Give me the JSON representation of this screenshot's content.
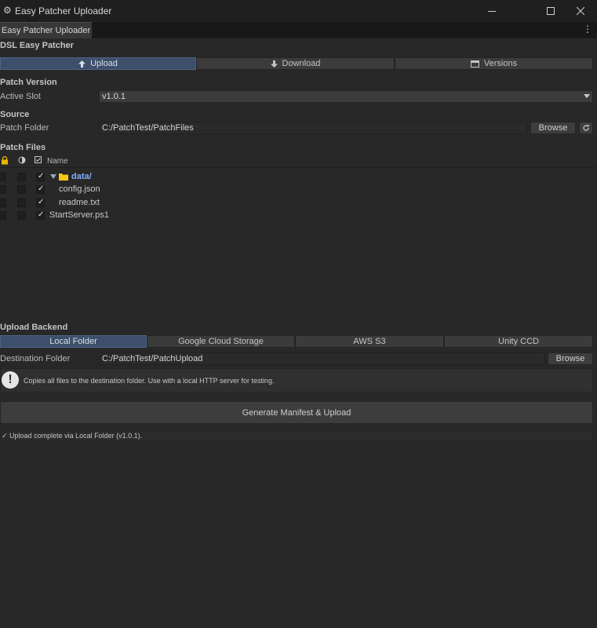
{
  "window": {
    "title": "Easy Patcher Uploader",
    "icon": "gears-icon"
  },
  "tab": {
    "label": "Easy Patcher Uploader"
  },
  "header": {
    "title": "DSL Easy Patcher"
  },
  "modes": [
    {
      "label": "Upload",
      "icon": "upload-icon",
      "active": true
    },
    {
      "label": "Download",
      "icon": "download-icon",
      "active": false
    },
    {
      "label": "Versions",
      "icon": "calendar-icon",
      "active": false
    }
  ],
  "patch_version": {
    "section": "Patch Version",
    "active_slot_label": "Active Slot",
    "active_slot_value": "v1.0.1"
  },
  "source": {
    "section": "Source",
    "folder_label": "Patch Folder",
    "folder_value": "C:/PatchTest/PatchFiles",
    "browse_label": "Browse"
  },
  "patch_files": {
    "section": "Patch Files",
    "name_header": "Name",
    "rows": [
      {
        "name": "data/",
        "is_folder": true,
        "checked": true
      },
      {
        "name": "config.json",
        "is_folder": false,
        "checked": true
      },
      {
        "name": "readme.txt",
        "is_folder": false,
        "checked": true
      },
      {
        "name": "StartServer.ps1",
        "is_folder": false,
        "checked": true
      }
    ]
  },
  "upload_backend": {
    "section": "Upload Backend",
    "options": [
      {
        "label": "Local Folder",
        "active": true
      },
      {
        "label": "Google Cloud Storage",
        "active": false
      },
      {
        "label": "AWS S3",
        "active": false
      },
      {
        "label": "Unity CCD",
        "active": false
      }
    ],
    "dest_label": "Destination Folder",
    "dest_value": "C:/PatchTest/PatchUpload",
    "browse_label": "Browse",
    "info": "Copies all files to the destination folder. Use with a local HTTP server for testing."
  },
  "action": {
    "label": "Generate Manifest & Upload"
  },
  "status": {
    "text": "✓ Upload complete via Local Folder (v1.0.1)."
  },
  "colors": {
    "active_tab": "#3d4f6a",
    "folder_text": "#7fb1ff",
    "folder_icon": "#f5c518",
    "lock_icon": "#e8b400"
  }
}
